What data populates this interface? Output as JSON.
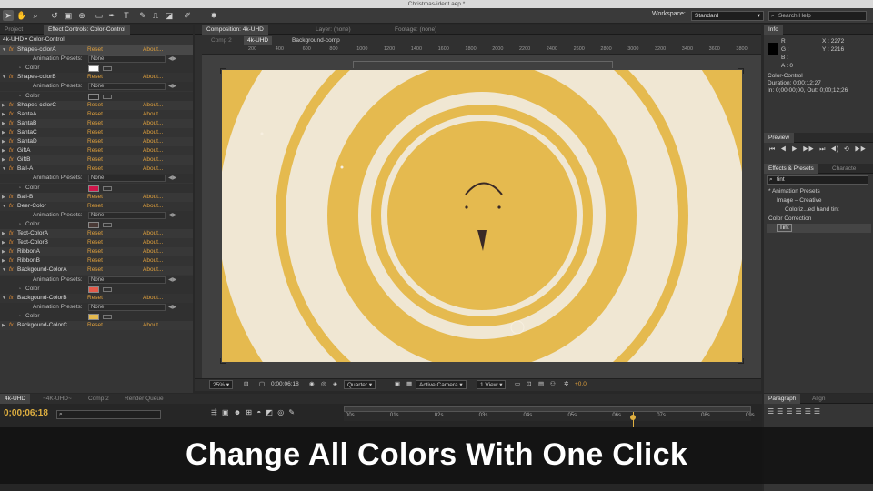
{
  "window": {
    "title": "Christmas-ident.aep *"
  },
  "toolbar": {
    "tools": [
      "selection-tool",
      "hand-tool",
      "zoom-tool",
      "rotate-tool",
      "camera-tool",
      "pan-behind-tool",
      "rectangle-tool",
      "pen-tool",
      "type-tool",
      "brush-tool",
      "clone-stamp-tool",
      "eraser-tool",
      "roto-brush-tool",
      "puppet-tool"
    ],
    "workspace_label": "Workspace:",
    "workspace_value": "Standard",
    "search_help_placeholder": "Search Help"
  },
  "left_panel": {
    "tabs": [
      "Project",
      "Effect Controls: Color-Control"
    ],
    "layer_path": "4k-UHD • Color-Control",
    "reset_label": "Reset",
    "about_label": "About...",
    "presets_label": "Animation Presets:",
    "presets_value": "None",
    "color_label": "Color",
    "effects": [
      {
        "name": "Shapes-colorA",
        "expanded": true,
        "color": "#ffffff"
      },
      {
        "name": "Shapes-colorB",
        "expanded": true,
        "color": "#2a2a2a"
      },
      {
        "name": "Shapes-colorC",
        "expanded": false
      },
      {
        "name": "SantaA",
        "expanded": false
      },
      {
        "name": "SantaB",
        "expanded": false
      },
      {
        "name": "SantaC",
        "expanded": false
      },
      {
        "name": "SantaD",
        "expanded": false
      },
      {
        "name": "GiftA",
        "expanded": false
      },
      {
        "name": "GiftB",
        "expanded": false
      },
      {
        "name": "Ball-A",
        "expanded": true,
        "color": "#d0164b"
      },
      {
        "name": "Ball-B",
        "expanded": false
      },
      {
        "name": "Deer-Color",
        "expanded": true,
        "color": "#4a3a36"
      },
      {
        "name": "Text-ColorA",
        "expanded": false
      },
      {
        "name": "Text-ColorB",
        "expanded": false
      },
      {
        "name": "RibbonA",
        "expanded": false
      },
      {
        "name": "RibbonB",
        "expanded": false
      },
      {
        "name": "Backgound-ColorA",
        "expanded": true,
        "color": "#e45a4a"
      },
      {
        "name": "Backgound-ColorB",
        "expanded": true,
        "color": "#e5ba4f"
      },
      {
        "name": "Backgound-ColorC",
        "expanded": false
      }
    ]
  },
  "composition": {
    "tabs": [
      "Composition: 4k-UHD",
      "Layer: (none)",
      "Footage: (none)"
    ],
    "breadcrumbs": [
      "Comp 2",
      "4k-UHD",
      "Background-comp"
    ],
    "ruler_labels": [
      "200",
      "400",
      "600",
      "800",
      "1000",
      "1200",
      "1400",
      "1600",
      "1800",
      "2000",
      "2200",
      "2400",
      "2600",
      "2800",
      "3000",
      "3200",
      "3400",
      "3600",
      "3800"
    ],
    "colors": {
      "background": "#e5ba4f",
      "ring": "#f0e7d3",
      "face": "#3a2a26",
      "stripe": "#e0606a"
    }
  },
  "viewer_bar": {
    "zoom": "25%",
    "timecode": "0;00;06;18",
    "resolution": "Quarter",
    "camera": "Active Camera",
    "views": "1 View",
    "exposure": "+0.0"
  },
  "info_panel": {
    "title": "Info",
    "r_label": "R :",
    "g_label": "G :",
    "b_label": "B :",
    "a_label": "A : 0",
    "x": "X : 2272",
    "y": "Y : 2216",
    "layer": "Color-Control",
    "duration": "Duration: 0;00;12;27",
    "in_out": "In: 0;00;00;00, Out: 0;00;12;26"
  },
  "preview_panel": {
    "title": "Preview"
  },
  "effects_presets": {
    "tabs": [
      "Effects & Presets",
      "Characte"
    ],
    "query": "tint",
    "tree": [
      {
        "label": "* Animation Presets",
        "level": 0
      },
      {
        "label": "Image – Creative",
        "level": 1
      },
      {
        "label": "Coloriz...ed hand tint",
        "level": 2
      },
      {
        "label": "Color Correction",
        "level": 0
      },
      {
        "label": "Tint",
        "level": 1,
        "selected": true
      }
    ]
  },
  "paragraph_panel": {
    "tabs": [
      "Paragraph",
      "Align"
    ]
  },
  "timeline": {
    "tabs": [
      "4k-UHD",
      "~4K-UHD~",
      "Comp 2",
      "Render Queue"
    ],
    "timecode": "0;00;06;18",
    "ticks": [
      "00s",
      "01s",
      "02s",
      "03s",
      "04s",
      "05s",
      "06s",
      "07s",
      "08s",
      "09s"
    ],
    "playhead": 0.71
  },
  "caption": "Change All Colors With One Click"
}
